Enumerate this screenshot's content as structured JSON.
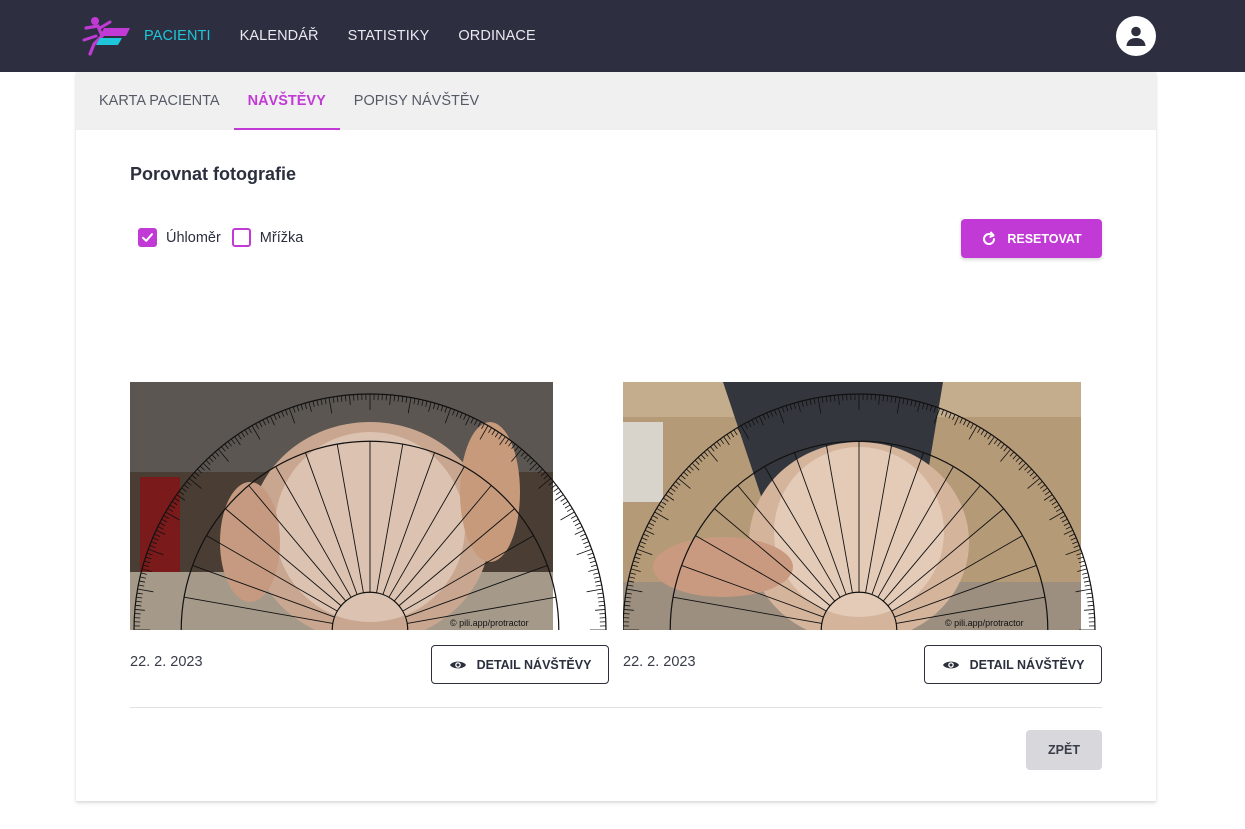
{
  "nav": {
    "items": [
      {
        "label": "PACIENTI",
        "active": true
      },
      {
        "label": "KALENDÁŘ",
        "active": false
      },
      {
        "label": "STATISTIKY",
        "active": false
      },
      {
        "label": "ORDINACE",
        "active": false
      }
    ],
    "avatar_icon": "user-icon"
  },
  "tabs": [
    {
      "label": "KARTA PACIENTA",
      "active": false
    },
    {
      "label": "NÁVŠTĚVY",
      "active": true
    },
    {
      "label": "POPISY NÁVŠTĚV",
      "active": false
    }
  ],
  "page": {
    "title": "Porovnat fotografie",
    "options": [
      {
        "label": "Úhloměr",
        "checked": true
      },
      {
        "label": "Mřížka",
        "checked": false
      }
    ],
    "reset_label": "RESETOVAT",
    "photos": [
      {
        "date": "22. 2. 2023",
        "detail_label": "DETAIL NÁVŠTĚVY",
        "watermark": "© pili.app/protractor"
      },
      {
        "date": "22. 2. 2023",
        "detail_label": "DETAIL NÁVŠTĚVY",
        "watermark": "© pili.app/protractor"
      }
    ],
    "back_label": "ZPĚT"
  },
  "colors": {
    "accent": "#c23ad6",
    "nav_active": "#1fc6da",
    "topbar": "#2d2f40"
  }
}
